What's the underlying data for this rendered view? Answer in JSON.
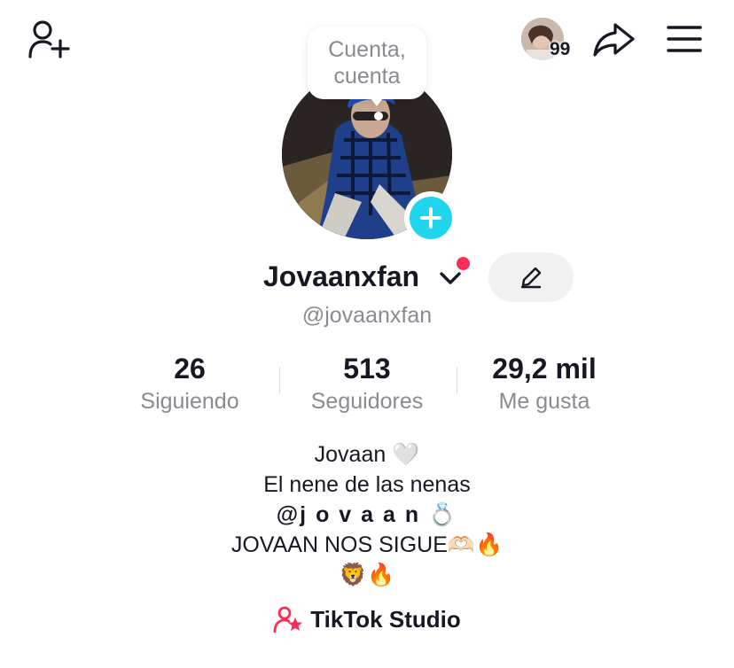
{
  "header": {
    "notification_count": "99",
    "icons": [
      "add-friend-icon",
      "avatar-switcher",
      "share-icon",
      "menu-icon"
    ]
  },
  "tooltip": {
    "text": "Cuenta,\ncuenta"
  },
  "profile": {
    "display_name": "Jovaanxfan",
    "username": "@jovaanxfan"
  },
  "stats": {
    "following_value": "26",
    "following_label": "Siguiendo",
    "followers_value": "513",
    "followers_label": "Seguidores",
    "likes_value": "29,2 mil",
    "likes_label": "Me gusta"
  },
  "bio": {
    "line1": "Jovaan 🤍",
    "line2": "El nene de las nenas",
    "line3": "@j o v a a n 💍",
    "line4": "JOVAAN NOS SIGUE🫶🏻🔥",
    "line5": "🦁🔥"
  },
  "studio": {
    "label": "TikTok Studio"
  },
  "colors": {
    "accent_red": "#fe2c55",
    "accent_cyan": "#20d5ec",
    "muted_text": "#8a8b91",
    "primary_text": "#161823"
  }
}
